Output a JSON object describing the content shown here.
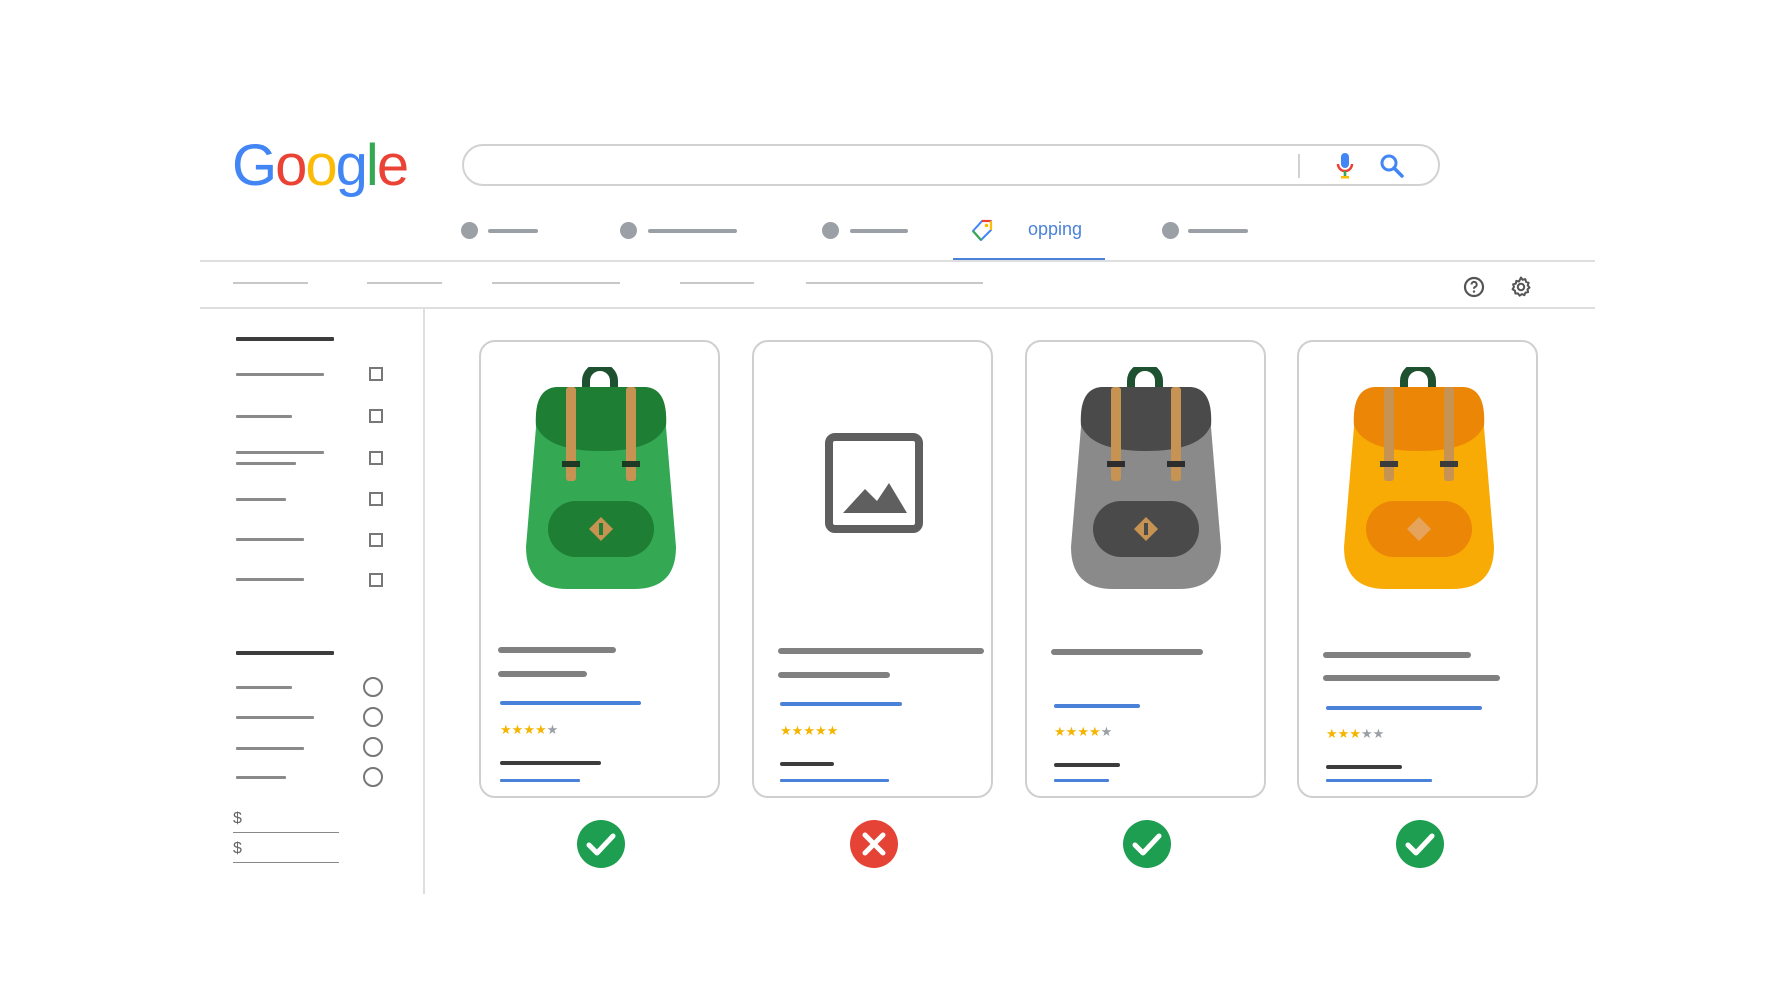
{
  "logo": {
    "letters": [
      "G",
      "o",
      "o",
      "g",
      "l",
      "e"
    ],
    "colors": [
      "#4285F4",
      "#EA4335",
      "#FBBC05",
      "#4285F4",
      "#34A853",
      "#EA4335"
    ]
  },
  "search": {
    "value": "",
    "placeholder": "",
    "mic_icon": "microphone-icon",
    "search_icon": "magnifier-icon"
  },
  "tabs": {
    "active_label": "opping",
    "active_icon": "shopping-tag-icon"
  },
  "toolbar": {
    "help_icon": "help-icon",
    "settings_icon": "gear-icon"
  },
  "filters": {
    "price_min_symbol": "$",
    "price_max_symbol": "$"
  },
  "products": [
    {
      "image": "green-backpack",
      "rating": 4,
      "status": "approved",
      "status_icon": "check-icon"
    },
    {
      "image": "image-placeholder",
      "rating": 5,
      "status": "rejected",
      "status_icon": "cross-icon"
    },
    {
      "image": "gray-backpack",
      "rating": 4,
      "status": "approved",
      "status_icon": "check-icon"
    },
    {
      "image": "orange-backpack",
      "rating": 3,
      "status": "approved",
      "status_icon": "check-icon"
    }
  ],
  "colors": {
    "accent_blue": "#4a82d9",
    "approved_green": "#1e9e50",
    "rejected_red": "#e54335",
    "rating_star": "#f4b400"
  }
}
